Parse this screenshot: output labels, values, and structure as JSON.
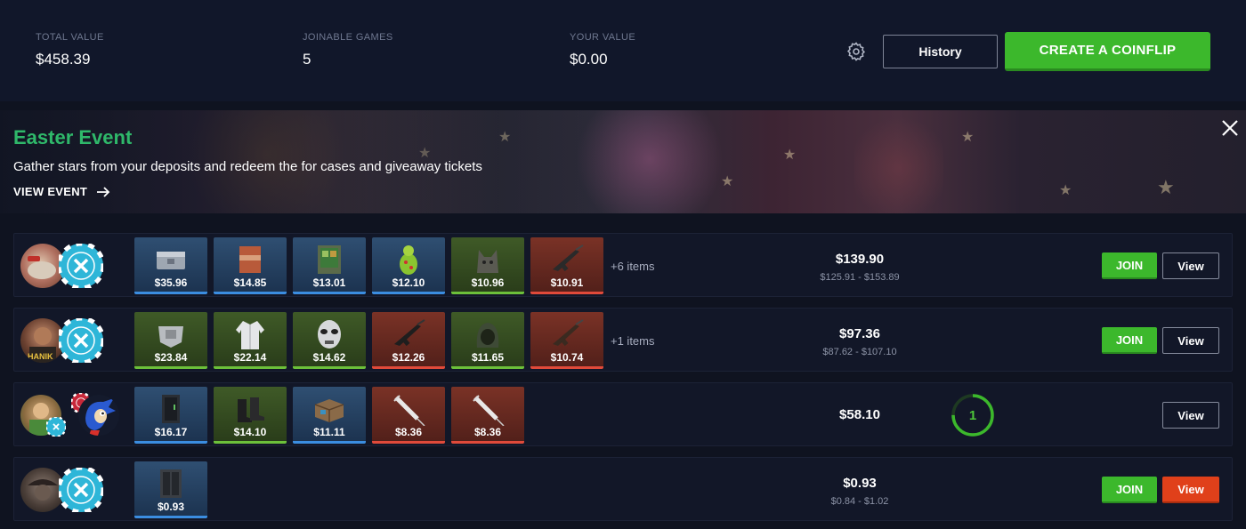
{
  "stats": {
    "total_value": {
      "label": "TOTAL VALUE",
      "value": "$458.39"
    },
    "joinable_games": {
      "label": "JOINABLE GAMES",
      "value": "5"
    },
    "your_value": {
      "label": "YOUR VALUE",
      "value": "$0.00"
    }
  },
  "header": {
    "history_label": "History",
    "create_label": "CREATE A COINFLIP"
  },
  "banner": {
    "title": "Easter Event",
    "subtitle": "Gather stars from your deposits and redeem the for cases and giveaway tickets",
    "link": "VIEW EVENT"
  },
  "rows": [
    {
      "items": [
        {
          "price": "$35.96",
          "rarity": "blue",
          "icon": "case-icon"
        },
        {
          "price": "$14.85",
          "rarity": "blue",
          "icon": "global-box-icon"
        },
        {
          "price": "$13.01",
          "rarity": "blue",
          "icon": "vending-crate-icon"
        },
        {
          "price": "$12.10",
          "rarity": "blue",
          "icon": "green-figure-icon"
        },
        {
          "price": "$10.96",
          "rarity": "green",
          "icon": "wolf-helmet-icon"
        },
        {
          "price": "$10.91",
          "rarity": "red",
          "icon": "rifle-icon"
        }
      ],
      "more": "+6 items",
      "total": "$139.90",
      "range": "$125.91 - $153.89",
      "join_label": "JOIN",
      "view_label": "View"
    },
    {
      "items": [
        {
          "price": "$23.84",
          "rarity": "green",
          "icon": "armor-icon"
        },
        {
          "price": "$22.14",
          "rarity": "green",
          "icon": "jacket-icon"
        },
        {
          "price": "$14.62",
          "rarity": "green",
          "icon": "mask-icon"
        },
        {
          "price": "$12.26",
          "rarity": "red",
          "icon": "rifle-icon"
        },
        {
          "price": "$11.65",
          "rarity": "green",
          "icon": "hood-icon"
        },
        {
          "price": "$10.74",
          "rarity": "red",
          "icon": "rifle-icon"
        }
      ],
      "more": "+1 items",
      "total": "$97.36",
      "range": "$87.62 - $107.10",
      "join_label": "JOIN",
      "view_label": "View"
    },
    {
      "items": [
        {
          "price": "$16.17",
          "rarity": "blue",
          "icon": "locker-icon"
        },
        {
          "price": "$14.10",
          "rarity": "green",
          "icon": "boots-icon"
        },
        {
          "price": "$11.11",
          "rarity": "blue",
          "icon": "crate-icon"
        },
        {
          "price": "$8.36",
          "rarity": "red",
          "icon": "syringe-icon"
        },
        {
          "price": "$8.36",
          "rarity": "red",
          "icon": "syringe-icon"
        }
      ],
      "total": "$58.10",
      "countdown": "1",
      "countdown_fraction": 0.25,
      "view_label": "View"
    },
    {
      "items": [
        {
          "price": "$0.93",
          "rarity": "blue",
          "icon": "locker-icon"
        }
      ],
      "total": "$0.93",
      "range": "$0.84 - $1.02",
      "join_label": "JOIN",
      "view_label": "View"
    }
  ]
}
